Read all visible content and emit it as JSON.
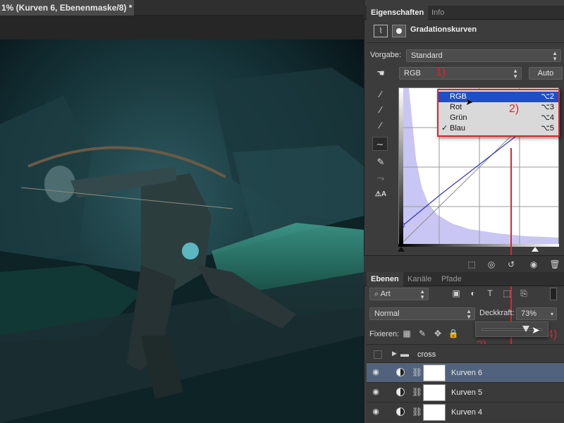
{
  "document": {
    "tab_title": "1% (Kurven 6, Ebenenmaske/8) *"
  },
  "properties_panel": {
    "tabs": [
      "Eigenschaften",
      "Info"
    ],
    "header_title": "Gradationskurven",
    "preset_label": "Vorgabe:",
    "preset_value": "Standard",
    "channel_value": "RGB",
    "auto_button": "Auto",
    "channel_menu": [
      {
        "label": "RGB",
        "shortcut": "⌥2",
        "highlighted": true,
        "checked": false
      },
      {
        "label": "Rot",
        "shortcut": "⌥3",
        "highlighted": false,
        "checked": false
      },
      {
        "label": "Grün",
        "shortcut": "⌥4",
        "highlighted": false,
        "checked": false
      },
      {
        "label": "Blau",
        "shortcut": "⌥5",
        "highlighted": false,
        "checked": true
      }
    ]
  },
  "annotations": {
    "a1": "1)",
    "a2": "2)",
    "a3": "3)",
    "a4": "4)",
    "color": "#e0242a"
  },
  "layers_panel": {
    "tabs": [
      "Ebenen",
      "Kanäle",
      "Pfade"
    ],
    "filter_value": "Art",
    "blend_mode": "Normal",
    "opacity_label": "Deckkraft:",
    "opacity_value": "73%",
    "opacity_slider_fraction": 0.73,
    "lock_label": "Fixieren:",
    "group_name": "cross",
    "layers": [
      {
        "name": "Kurven 6",
        "selected": true
      },
      {
        "name": "Kurven 5",
        "selected": false
      },
      {
        "name": "Kurven 4",
        "selected": false
      }
    ]
  },
  "colors": {
    "accent_blue": "#1e4fc9",
    "selected_layer": "#51637c",
    "histogram_fill": "#c9c6f4"
  }
}
